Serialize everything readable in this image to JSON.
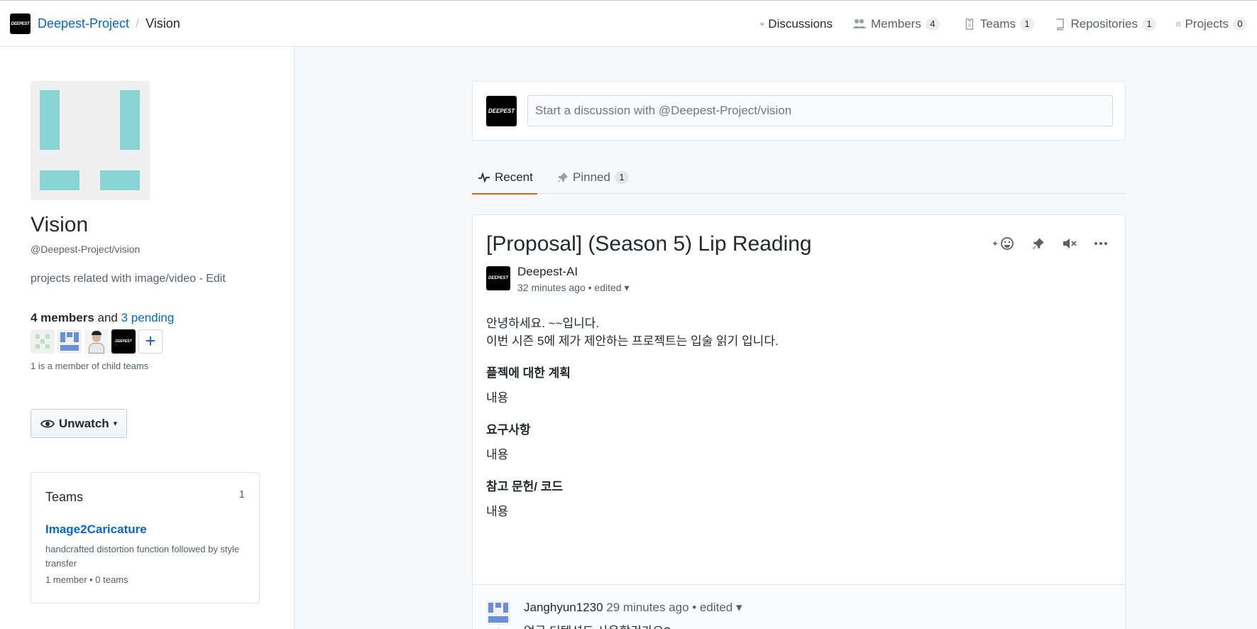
{
  "header": {
    "org_logo_text": "DEEPEST",
    "org": "Deepest-Project",
    "separator": "/",
    "team": "Vision",
    "nav": [
      {
        "label": "Discussions",
        "count": "",
        "icon": "comment-discussion-icon",
        "active": true
      },
      {
        "label": "Members",
        "count": "4",
        "icon": "people-icon",
        "active": false
      },
      {
        "label": "Teams",
        "count": "1",
        "icon": "jersey-icon",
        "active": false
      },
      {
        "label": "Repositories",
        "count": "1",
        "icon": "repo-icon",
        "active": false
      },
      {
        "label": "Projects",
        "count": "0",
        "icon": "project-icon",
        "active": false
      }
    ]
  },
  "sidebar": {
    "team_name": "Vision",
    "team_slug": "@Deepest-Project/vision",
    "description": "projects related with image/video - Edit",
    "members_count": "4 members",
    "members_and": "and",
    "pending": "3 pending",
    "avatar_logo_text": "DEEPEST",
    "add_symbol": "+",
    "child_note": "1 is a member of child teams",
    "unwatch_label": "Unwatch",
    "teams_box": {
      "title": "Teams",
      "count": "1",
      "team_name": "Image2Caricature",
      "team_desc": "handcrafted distortion function followed by style transfer",
      "team_meta": "1 member • 0 teams"
    }
  },
  "main": {
    "composer_logo_text": "DEEPEST",
    "composer_placeholder": "Start a discussion with @Deepest-Project/vision",
    "tabs": {
      "recent": "Recent",
      "pinned": "Pinned",
      "pinned_count": "1"
    },
    "post": {
      "title": "[Proposal] (Season 5) Lip Reading",
      "author": "Deepest-AI",
      "author_logo_text": "DEEPEST",
      "meta": "32 minutes ago • edited ▾",
      "line1": "안녕하세요. ~~입니다.",
      "line2": "이번 시즌 5에 제가 제안하는 프로젝트는 입술 읽기 입니다.",
      "h1": "플젝에 대한 계획",
      "p1": "내용",
      "h2": "요구사항",
      "p2": "내용",
      "h3": "참고 문헌/ 코드",
      "p3": "내용"
    },
    "comment": {
      "author": "Janghyun1230",
      "meta": "29 minutes ago • edited ▾",
      "text": "얼굴 디텍션도 사용할건가요?"
    }
  },
  "colors": {
    "accent": "#e36209",
    "link": "#0366d6",
    "avatar_teal": "#88d3d3"
  }
}
